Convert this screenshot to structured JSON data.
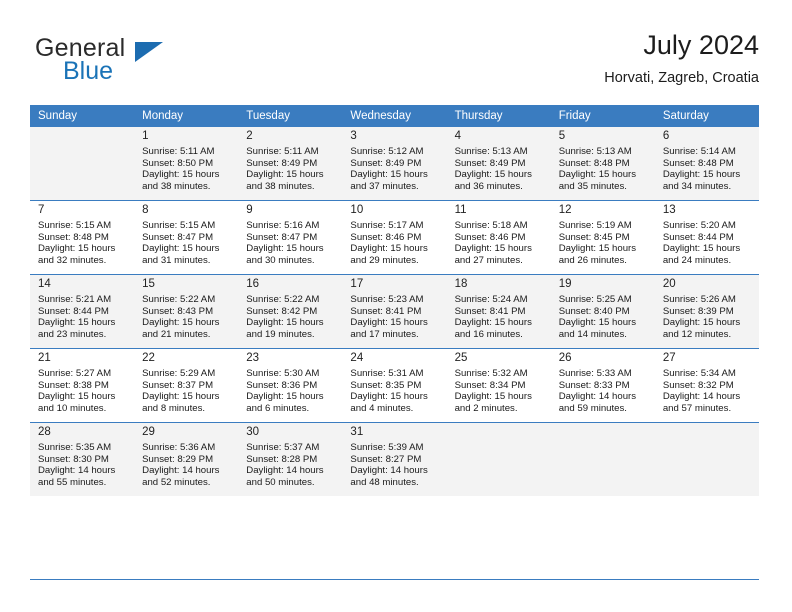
{
  "brand": {
    "name_part1": "General",
    "name_part2": "Blue",
    "triangle_color": "#1c6cb0"
  },
  "header": {
    "title": "July 2024",
    "location": "Horvati, Zagreb, Croatia"
  },
  "theme": {
    "header_blue": "#3a7cc0",
    "shaded_row": "#f3f3f3",
    "text": "#1a1a1a"
  },
  "weekdays": [
    "Sunday",
    "Monday",
    "Tuesday",
    "Wednesday",
    "Thursday",
    "Friday",
    "Saturday"
  ],
  "weeks": [
    [
      {
        "day": "",
        "sunrise": "",
        "sunset": "",
        "daylight_line1": "",
        "daylight_line2": ""
      },
      {
        "day": "1",
        "sunrise": "Sunrise: 5:11 AM",
        "sunset": "Sunset: 8:50 PM",
        "daylight_line1": "Daylight: 15 hours",
        "daylight_line2": "and 38 minutes."
      },
      {
        "day": "2",
        "sunrise": "Sunrise: 5:11 AM",
        "sunset": "Sunset: 8:49 PM",
        "daylight_line1": "Daylight: 15 hours",
        "daylight_line2": "and 38 minutes."
      },
      {
        "day": "3",
        "sunrise": "Sunrise: 5:12 AM",
        "sunset": "Sunset: 8:49 PM",
        "daylight_line1": "Daylight: 15 hours",
        "daylight_line2": "and 37 minutes."
      },
      {
        "day": "4",
        "sunrise": "Sunrise: 5:13 AM",
        "sunset": "Sunset: 8:49 PM",
        "daylight_line1": "Daylight: 15 hours",
        "daylight_line2": "and 36 minutes."
      },
      {
        "day": "5",
        "sunrise": "Sunrise: 5:13 AM",
        "sunset": "Sunset: 8:48 PM",
        "daylight_line1": "Daylight: 15 hours",
        "daylight_line2": "and 35 minutes."
      },
      {
        "day": "6",
        "sunrise": "Sunrise: 5:14 AM",
        "sunset": "Sunset: 8:48 PM",
        "daylight_line1": "Daylight: 15 hours",
        "daylight_line2": "and 34 minutes."
      }
    ],
    [
      {
        "day": "7",
        "sunrise": "Sunrise: 5:15 AM",
        "sunset": "Sunset: 8:48 PM",
        "daylight_line1": "Daylight: 15 hours",
        "daylight_line2": "and 32 minutes."
      },
      {
        "day": "8",
        "sunrise": "Sunrise: 5:15 AM",
        "sunset": "Sunset: 8:47 PM",
        "daylight_line1": "Daylight: 15 hours",
        "daylight_line2": "and 31 minutes."
      },
      {
        "day": "9",
        "sunrise": "Sunrise: 5:16 AM",
        "sunset": "Sunset: 8:47 PM",
        "daylight_line1": "Daylight: 15 hours",
        "daylight_line2": "and 30 minutes."
      },
      {
        "day": "10",
        "sunrise": "Sunrise: 5:17 AM",
        "sunset": "Sunset: 8:46 PM",
        "daylight_line1": "Daylight: 15 hours",
        "daylight_line2": "and 29 minutes."
      },
      {
        "day": "11",
        "sunrise": "Sunrise: 5:18 AM",
        "sunset": "Sunset: 8:46 PM",
        "daylight_line1": "Daylight: 15 hours",
        "daylight_line2": "and 27 minutes."
      },
      {
        "day": "12",
        "sunrise": "Sunrise: 5:19 AM",
        "sunset": "Sunset: 8:45 PM",
        "daylight_line1": "Daylight: 15 hours",
        "daylight_line2": "and 26 minutes."
      },
      {
        "day": "13",
        "sunrise": "Sunrise: 5:20 AM",
        "sunset": "Sunset: 8:44 PM",
        "daylight_line1": "Daylight: 15 hours",
        "daylight_line2": "and 24 minutes."
      }
    ],
    [
      {
        "day": "14",
        "sunrise": "Sunrise: 5:21 AM",
        "sunset": "Sunset: 8:44 PM",
        "daylight_line1": "Daylight: 15 hours",
        "daylight_line2": "and 23 minutes."
      },
      {
        "day": "15",
        "sunrise": "Sunrise: 5:22 AM",
        "sunset": "Sunset: 8:43 PM",
        "daylight_line1": "Daylight: 15 hours",
        "daylight_line2": "and 21 minutes."
      },
      {
        "day": "16",
        "sunrise": "Sunrise: 5:22 AM",
        "sunset": "Sunset: 8:42 PM",
        "daylight_line1": "Daylight: 15 hours",
        "daylight_line2": "and 19 minutes."
      },
      {
        "day": "17",
        "sunrise": "Sunrise: 5:23 AM",
        "sunset": "Sunset: 8:41 PM",
        "daylight_line1": "Daylight: 15 hours",
        "daylight_line2": "and 17 minutes."
      },
      {
        "day": "18",
        "sunrise": "Sunrise: 5:24 AM",
        "sunset": "Sunset: 8:41 PM",
        "daylight_line1": "Daylight: 15 hours",
        "daylight_line2": "and 16 minutes."
      },
      {
        "day": "19",
        "sunrise": "Sunrise: 5:25 AM",
        "sunset": "Sunset: 8:40 PM",
        "daylight_line1": "Daylight: 15 hours",
        "daylight_line2": "and 14 minutes."
      },
      {
        "day": "20",
        "sunrise": "Sunrise: 5:26 AM",
        "sunset": "Sunset: 8:39 PM",
        "daylight_line1": "Daylight: 15 hours",
        "daylight_line2": "and 12 minutes."
      }
    ],
    [
      {
        "day": "21",
        "sunrise": "Sunrise: 5:27 AM",
        "sunset": "Sunset: 8:38 PM",
        "daylight_line1": "Daylight: 15 hours",
        "daylight_line2": "and 10 minutes."
      },
      {
        "day": "22",
        "sunrise": "Sunrise: 5:29 AM",
        "sunset": "Sunset: 8:37 PM",
        "daylight_line1": "Daylight: 15 hours",
        "daylight_line2": "and 8 minutes."
      },
      {
        "day": "23",
        "sunrise": "Sunrise: 5:30 AM",
        "sunset": "Sunset: 8:36 PM",
        "daylight_line1": "Daylight: 15 hours",
        "daylight_line2": "and 6 minutes."
      },
      {
        "day": "24",
        "sunrise": "Sunrise: 5:31 AM",
        "sunset": "Sunset: 8:35 PM",
        "daylight_line1": "Daylight: 15 hours",
        "daylight_line2": "and 4 minutes."
      },
      {
        "day": "25",
        "sunrise": "Sunrise: 5:32 AM",
        "sunset": "Sunset: 8:34 PM",
        "daylight_line1": "Daylight: 15 hours",
        "daylight_line2": "and 2 minutes."
      },
      {
        "day": "26",
        "sunrise": "Sunrise: 5:33 AM",
        "sunset": "Sunset: 8:33 PM",
        "daylight_line1": "Daylight: 14 hours",
        "daylight_line2": "and 59 minutes."
      },
      {
        "day": "27",
        "sunrise": "Sunrise: 5:34 AM",
        "sunset": "Sunset: 8:32 PM",
        "daylight_line1": "Daylight: 14 hours",
        "daylight_line2": "and 57 minutes."
      }
    ],
    [
      {
        "day": "28",
        "sunrise": "Sunrise: 5:35 AM",
        "sunset": "Sunset: 8:30 PM",
        "daylight_line1": "Daylight: 14 hours",
        "daylight_line2": "and 55 minutes."
      },
      {
        "day": "29",
        "sunrise": "Sunrise: 5:36 AM",
        "sunset": "Sunset: 8:29 PM",
        "daylight_line1": "Daylight: 14 hours",
        "daylight_line2": "and 52 minutes."
      },
      {
        "day": "30",
        "sunrise": "Sunrise: 5:37 AM",
        "sunset": "Sunset: 8:28 PM",
        "daylight_line1": "Daylight: 14 hours",
        "daylight_line2": "and 50 minutes."
      },
      {
        "day": "31",
        "sunrise": "Sunrise: 5:39 AM",
        "sunset": "Sunset: 8:27 PM",
        "daylight_line1": "Daylight: 14 hours",
        "daylight_line2": "and 48 minutes."
      },
      {
        "day": "",
        "sunrise": "",
        "sunset": "",
        "daylight_line1": "",
        "daylight_line2": ""
      },
      {
        "day": "",
        "sunrise": "",
        "sunset": "",
        "daylight_line1": "",
        "daylight_line2": ""
      },
      {
        "day": "",
        "sunrise": "",
        "sunset": "",
        "daylight_line1": "",
        "daylight_line2": ""
      }
    ]
  ]
}
